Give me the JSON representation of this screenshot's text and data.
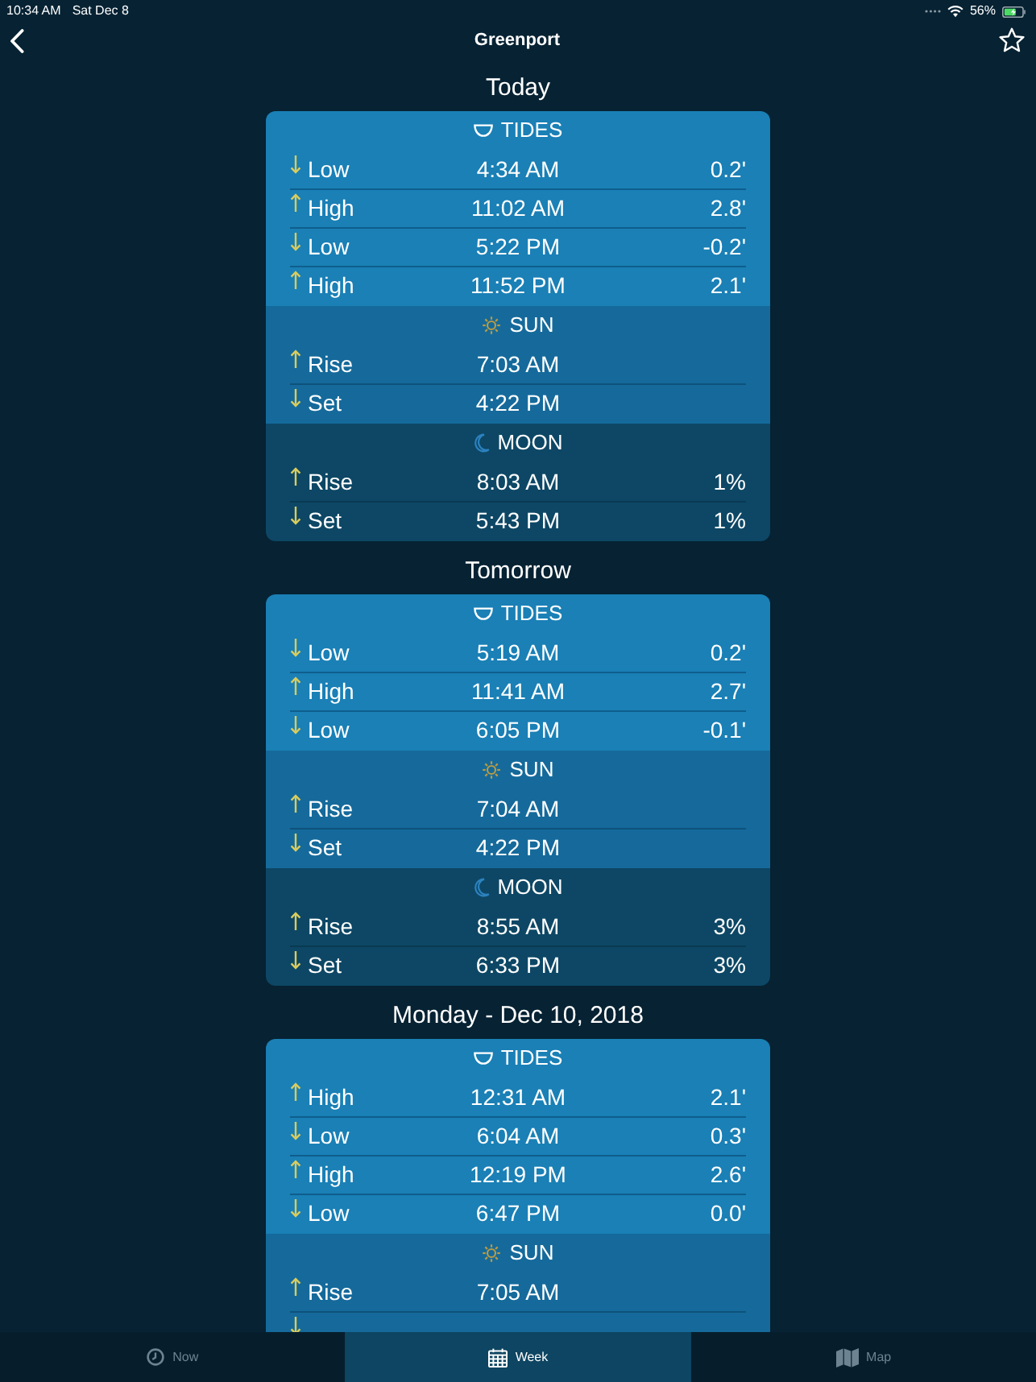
{
  "status_bar": {
    "time": "10:34 AM",
    "date": "Sat Dec 8",
    "battery": "56%"
  },
  "nav": {
    "title": "Greenport"
  },
  "days": [
    {
      "heading": "Today",
      "sections": [
        {
          "kind": "tides",
          "title": "TIDES",
          "rows": [
            {
              "rising": false,
              "label": "Low",
              "time": "4:34 AM",
              "value": "0.2'"
            },
            {
              "rising": true,
              "label": "High",
              "time": "11:02 AM",
              "value": "2.8'"
            },
            {
              "rising": false,
              "label": "Low",
              "time": "5:22 PM",
              "value": "-0.2'"
            },
            {
              "rising": true,
              "label": "High",
              "time": "11:52 PM",
              "value": "2.1'"
            }
          ]
        },
        {
          "kind": "sun",
          "title": "SUN",
          "rows": [
            {
              "rising": true,
              "label": "Rise",
              "time": "7:03 AM"
            },
            {
              "rising": false,
              "label": "Set",
              "time": "4:22 PM"
            }
          ]
        },
        {
          "kind": "moon",
          "title": "MOON",
          "rows": [
            {
              "rising": true,
              "label": "Rise",
              "time": "8:03 AM",
              "value": "1%"
            },
            {
              "rising": false,
              "label": "Set",
              "time": "5:43 PM",
              "value": "1%"
            }
          ]
        }
      ]
    },
    {
      "heading": "Tomorrow",
      "sections": [
        {
          "kind": "tides",
          "title": "TIDES",
          "rows": [
            {
              "rising": false,
              "label": "Low",
              "time": "5:19 AM",
              "value": "0.2'"
            },
            {
              "rising": true,
              "label": "High",
              "time": "11:41 AM",
              "value": "2.7'"
            },
            {
              "rising": false,
              "label": "Low",
              "time": "6:05 PM",
              "value": "-0.1'"
            }
          ]
        },
        {
          "kind": "sun",
          "title": "SUN",
          "rows": [
            {
              "rising": true,
              "label": "Rise",
              "time": "7:04 AM"
            },
            {
              "rising": false,
              "label": "Set",
              "time": "4:22 PM"
            }
          ]
        },
        {
          "kind": "moon",
          "title": "MOON",
          "rows": [
            {
              "rising": true,
              "label": "Rise",
              "time": "8:55 AM",
              "value": "3%"
            },
            {
              "rising": false,
              "label": "Set",
              "time": "6:33 PM",
              "value": "3%"
            }
          ]
        }
      ]
    },
    {
      "heading": "Monday - Dec 10, 2018",
      "sections": [
        {
          "kind": "tides",
          "title": "TIDES",
          "rows": [
            {
              "rising": true,
              "label": "High",
              "time": "12:31 AM",
              "value": "2.1'"
            },
            {
              "rising": false,
              "label": "Low",
              "time": "6:04 AM",
              "value": "0.3'"
            },
            {
              "rising": true,
              "label": "High",
              "time": "12:19 PM",
              "value": "2.6'"
            },
            {
              "rising": false,
              "label": "Low",
              "time": "6:47 PM",
              "value": "0.0'"
            }
          ]
        },
        {
          "kind": "sun",
          "title": "SUN",
          "rows": [
            {
              "rising": true,
              "label": "Rise",
              "time": "7:05 AM"
            },
            {
              "rising": false
            }
          ]
        }
      ]
    }
  ],
  "tabs": [
    {
      "label": "Now",
      "selected": false
    },
    {
      "label": "Week",
      "selected": true
    },
    {
      "label": "Map",
      "selected": false
    }
  ]
}
